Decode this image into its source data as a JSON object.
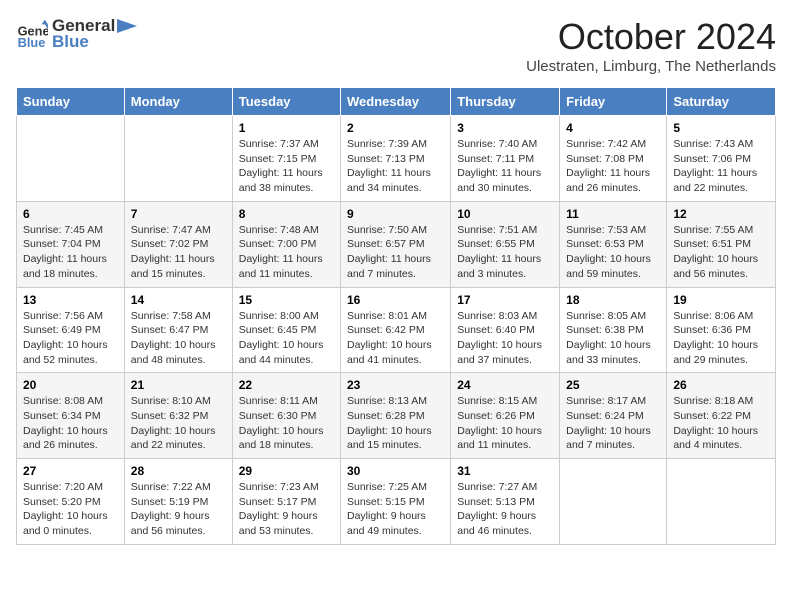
{
  "logo": {
    "line1": "General",
    "line2": "Blue"
  },
  "title": "October 2024",
  "location": "Ulestraten, Limburg, The Netherlands",
  "days_of_week": [
    "Sunday",
    "Monday",
    "Tuesday",
    "Wednesday",
    "Thursday",
    "Friday",
    "Saturday"
  ],
  "weeks": [
    [
      {
        "num": "",
        "info": ""
      },
      {
        "num": "",
        "info": ""
      },
      {
        "num": "1",
        "info": "Sunrise: 7:37 AM\nSunset: 7:15 PM\nDaylight: 11 hours and 38 minutes."
      },
      {
        "num": "2",
        "info": "Sunrise: 7:39 AM\nSunset: 7:13 PM\nDaylight: 11 hours and 34 minutes."
      },
      {
        "num": "3",
        "info": "Sunrise: 7:40 AM\nSunset: 7:11 PM\nDaylight: 11 hours and 30 minutes."
      },
      {
        "num": "4",
        "info": "Sunrise: 7:42 AM\nSunset: 7:08 PM\nDaylight: 11 hours and 26 minutes."
      },
      {
        "num": "5",
        "info": "Sunrise: 7:43 AM\nSunset: 7:06 PM\nDaylight: 11 hours and 22 minutes."
      }
    ],
    [
      {
        "num": "6",
        "info": "Sunrise: 7:45 AM\nSunset: 7:04 PM\nDaylight: 11 hours and 18 minutes."
      },
      {
        "num": "7",
        "info": "Sunrise: 7:47 AM\nSunset: 7:02 PM\nDaylight: 11 hours and 15 minutes."
      },
      {
        "num": "8",
        "info": "Sunrise: 7:48 AM\nSunset: 7:00 PM\nDaylight: 11 hours and 11 minutes."
      },
      {
        "num": "9",
        "info": "Sunrise: 7:50 AM\nSunset: 6:57 PM\nDaylight: 11 hours and 7 minutes."
      },
      {
        "num": "10",
        "info": "Sunrise: 7:51 AM\nSunset: 6:55 PM\nDaylight: 11 hours and 3 minutes."
      },
      {
        "num": "11",
        "info": "Sunrise: 7:53 AM\nSunset: 6:53 PM\nDaylight: 10 hours and 59 minutes."
      },
      {
        "num": "12",
        "info": "Sunrise: 7:55 AM\nSunset: 6:51 PM\nDaylight: 10 hours and 56 minutes."
      }
    ],
    [
      {
        "num": "13",
        "info": "Sunrise: 7:56 AM\nSunset: 6:49 PM\nDaylight: 10 hours and 52 minutes."
      },
      {
        "num": "14",
        "info": "Sunrise: 7:58 AM\nSunset: 6:47 PM\nDaylight: 10 hours and 48 minutes."
      },
      {
        "num": "15",
        "info": "Sunrise: 8:00 AM\nSunset: 6:45 PM\nDaylight: 10 hours and 44 minutes."
      },
      {
        "num": "16",
        "info": "Sunrise: 8:01 AM\nSunset: 6:42 PM\nDaylight: 10 hours and 41 minutes."
      },
      {
        "num": "17",
        "info": "Sunrise: 8:03 AM\nSunset: 6:40 PM\nDaylight: 10 hours and 37 minutes."
      },
      {
        "num": "18",
        "info": "Sunrise: 8:05 AM\nSunset: 6:38 PM\nDaylight: 10 hours and 33 minutes."
      },
      {
        "num": "19",
        "info": "Sunrise: 8:06 AM\nSunset: 6:36 PM\nDaylight: 10 hours and 29 minutes."
      }
    ],
    [
      {
        "num": "20",
        "info": "Sunrise: 8:08 AM\nSunset: 6:34 PM\nDaylight: 10 hours and 26 minutes."
      },
      {
        "num": "21",
        "info": "Sunrise: 8:10 AM\nSunset: 6:32 PM\nDaylight: 10 hours and 22 minutes."
      },
      {
        "num": "22",
        "info": "Sunrise: 8:11 AM\nSunset: 6:30 PM\nDaylight: 10 hours and 18 minutes."
      },
      {
        "num": "23",
        "info": "Sunrise: 8:13 AM\nSunset: 6:28 PM\nDaylight: 10 hours and 15 minutes."
      },
      {
        "num": "24",
        "info": "Sunrise: 8:15 AM\nSunset: 6:26 PM\nDaylight: 10 hours and 11 minutes."
      },
      {
        "num": "25",
        "info": "Sunrise: 8:17 AM\nSunset: 6:24 PM\nDaylight: 10 hours and 7 minutes."
      },
      {
        "num": "26",
        "info": "Sunrise: 8:18 AM\nSunset: 6:22 PM\nDaylight: 10 hours and 4 minutes."
      }
    ],
    [
      {
        "num": "27",
        "info": "Sunrise: 7:20 AM\nSunset: 5:20 PM\nDaylight: 10 hours and 0 minutes."
      },
      {
        "num": "28",
        "info": "Sunrise: 7:22 AM\nSunset: 5:19 PM\nDaylight: 9 hours and 56 minutes."
      },
      {
        "num": "29",
        "info": "Sunrise: 7:23 AM\nSunset: 5:17 PM\nDaylight: 9 hours and 53 minutes."
      },
      {
        "num": "30",
        "info": "Sunrise: 7:25 AM\nSunset: 5:15 PM\nDaylight: 9 hours and 49 minutes."
      },
      {
        "num": "31",
        "info": "Sunrise: 7:27 AM\nSunset: 5:13 PM\nDaylight: 9 hours and 46 minutes."
      },
      {
        "num": "",
        "info": ""
      },
      {
        "num": "",
        "info": ""
      }
    ]
  ]
}
